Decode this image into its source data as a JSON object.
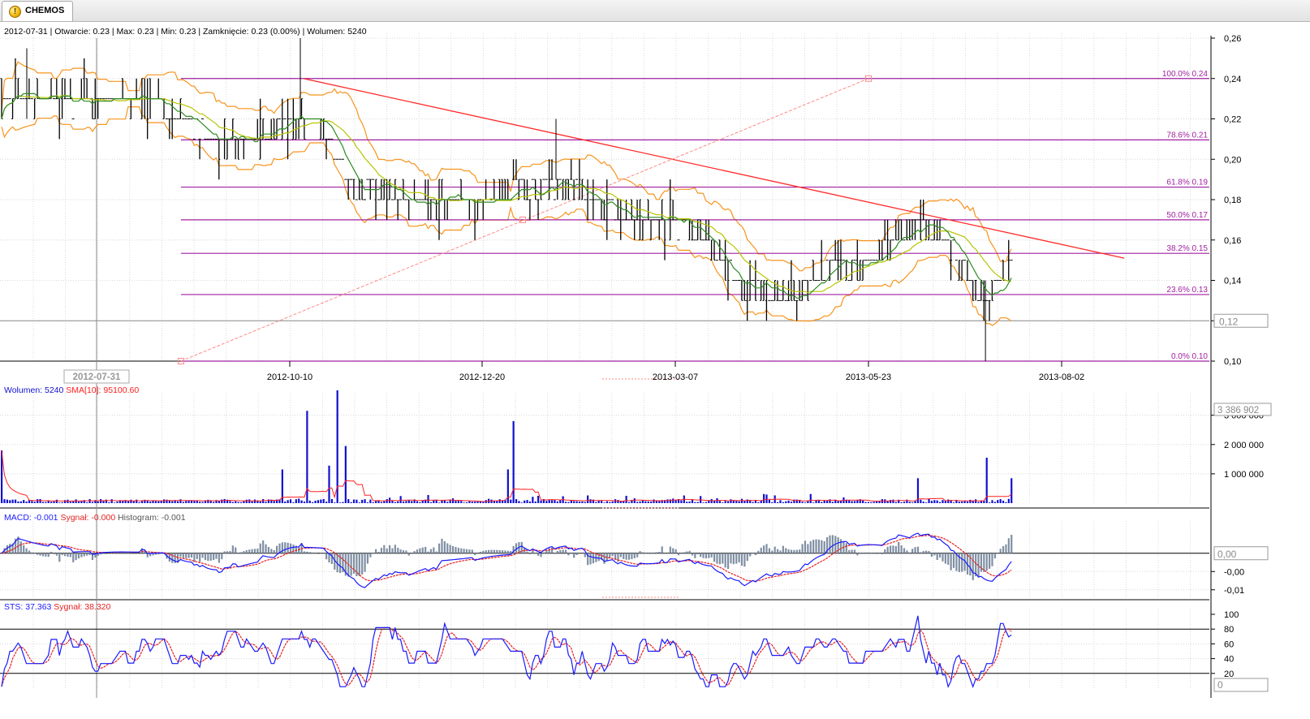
{
  "tab": {
    "icon": "warning-icon",
    "label": "CHEMOS"
  },
  "info": {
    "date": "2012-07-31",
    "open_label": "Otwarcie:",
    "open": "0.23",
    "max_label": "Max:",
    "max": "0.23",
    "min_label": "Min:",
    "min": "0.23",
    "close_label": "Zamknięcie:",
    "close": "0.23 (0.00%)",
    "volume_label": "Wolumen:",
    "volume": "5240"
  },
  "colors": {
    "price": "#000000",
    "band": "#f7941d",
    "ma_fast": "#2e8b22",
    "ma_slow": "#b8c400",
    "fib": "#a020a0",
    "trend": "#ff2a2a",
    "volume": "#1010d0",
    "sma": "#ff2020",
    "macd": "#1a1aff",
    "signal": "#e52222",
    "histogram": "#7f8fa3"
  },
  "chart_data": [
    {
      "panel": "price",
      "type": "ohlc",
      "ylim": [
        0.1,
        0.26
      ],
      "yticks": [
        "0,10",
        "0,12",
        "0,14",
        "0,16",
        "0,18",
        "0,20",
        "0,22",
        "0,24",
        "0,26"
      ],
      "cursor_label": "0,12",
      "cursor_value": 0.12,
      "xticks": [
        "2012-10-10",
        "2012-12-20",
        "2013-03-07",
        "2013-05-23",
        "2013-08-02"
      ],
      "cursor_date": "2012-07-31",
      "fibonacci": [
        {
          "label": "100.0% 0.24",
          "value": 0.24
        },
        {
          "label": "78.6% 0.21",
          "value": 0.2096
        },
        {
          "label": "61.8% 0.19",
          "value": 0.1862
        },
        {
          "label": "50.0% 0.17",
          "value": 0.17
        },
        {
          "label": "38.2% 0.15",
          "value": 0.1534
        },
        {
          "label": "23.6% 0.13",
          "value": 0.133
        },
        {
          "label": "0.0% 0.10",
          "value": 0.1
        }
      ],
      "close_approx": [
        [
          "2012-06-01",
          0.23
        ],
        [
          "2012-07-01",
          0.23
        ],
        [
          "2012-07-31",
          0.23
        ],
        [
          "2012-08-20",
          0.23
        ],
        [
          "2012-09-10",
          0.21
        ],
        [
          "2012-09-30",
          0.21
        ],
        [
          "2012-10-10",
          0.22
        ],
        [
          "2012-10-20",
          0.22
        ],
        [
          "2012-11-01",
          0.19
        ],
        [
          "2012-11-20",
          0.18
        ],
        [
          "2012-12-20",
          0.18
        ],
        [
          "2013-01-20",
          0.19
        ],
        [
          "2013-02-01",
          0.18
        ],
        [
          "2013-02-20",
          0.17
        ],
        [
          "2013-03-07",
          0.17
        ],
        [
          "2013-03-20",
          0.16
        ],
        [
          "2013-04-01",
          0.14
        ],
        [
          "2013-04-20",
          0.13
        ],
        [
          "2013-05-01",
          0.14
        ],
        [
          "2013-05-23",
          0.15
        ],
        [
          "2013-06-10",
          0.17
        ],
        [
          "2013-06-20",
          0.16
        ],
        [
          "2013-07-05",
          0.13
        ],
        [
          "2013-07-15",
          0.15
        ]
      ]
    },
    {
      "panel": "volume",
      "type": "bar",
      "legend_name": "Wolumen:",
      "legend_value": "5240",
      "sma_name": "SMA[10]:",
      "sma_value": "95100.60",
      "yticks": [
        "1 000 000",
        "2 000 000",
        "3 000 000"
      ],
      "max_label": "3 386 902",
      "ylim": [
        0,
        3600000
      ],
      "spikes": [
        [
          "2012-06-12",
          1800000
        ],
        [
          "2012-10-16",
          3150000
        ],
        [
          "2012-10-28",
          3850000
        ],
        [
          "2012-10-31",
          1950000
        ],
        [
          "2012-10-25",
          1280000
        ],
        [
          "2012-10-07",
          1150000
        ],
        [
          "2013-01-02",
          2800000
        ],
        [
          "2012-12-30",
          1150000
        ],
        [
          "2013-06-10",
          850000
        ],
        [
          "2013-07-05",
          1550000
        ],
        [
          "2013-07-15",
          850000
        ]
      ]
    },
    {
      "panel": "macd",
      "type": "line",
      "legend": {
        "macd": "MACD: -0.001",
        "signal": "Sygnał: -0.000",
        "histogram": "Histogram: -0.001"
      },
      "yticks": [
        "-0,00",
        "-0,01"
      ],
      "cursor_label": "0,00",
      "ylim": [
        -0.0125,
        0.0075
      ]
    },
    {
      "panel": "sts",
      "type": "line",
      "legend": {
        "sts": "STS: 37.363",
        "signal": "Sygnał: 38.320"
      },
      "yticks": [
        "20",
        "40",
        "60",
        "80",
        "100"
      ],
      "cursor_label": "0",
      "ylim": [
        0,
        100
      ],
      "levels": [
        20,
        80
      ]
    }
  ]
}
